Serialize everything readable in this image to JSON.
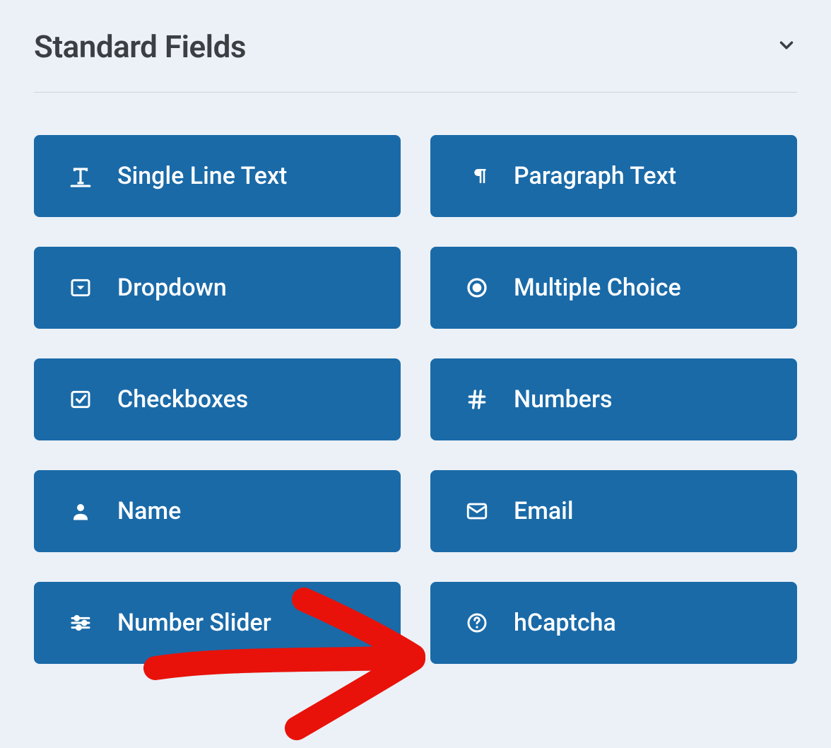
{
  "section": {
    "title": "Standard Fields"
  },
  "fields": [
    {
      "label": "Single Line Text",
      "icon": "text-icon"
    },
    {
      "label": "Paragraph Text",
      "icon": "paragraph-icon"
    },
    {
      "label": "Dropdown",
      "icon": "dropdown-icon"
    },
    {
      "label": "Multiple Choice",
      "icon": "radio-icon"
    },
    {
      "label": "Checkboxes",
      "icon": "checkbox-icon"
    },
    {
      "label": "Numbers",
      "icon": "hash-icon"
    },
    {
      "label": "Name",
      "icon": "user-icon"
    },
    {
      "label": "Email",
      "icon": "envelope-icon"
    },
    {
      "label": "Number Slider",
      "icon": "sliders-icon"
    },
    {
      "label": "hCaptcha",
      "icon": "question-circle-icon"
    }
  ],
  "annotation": {
    "type": "arrow",
    "color": "#e8120a",
    "target": "hCaptcha"
  }
}
